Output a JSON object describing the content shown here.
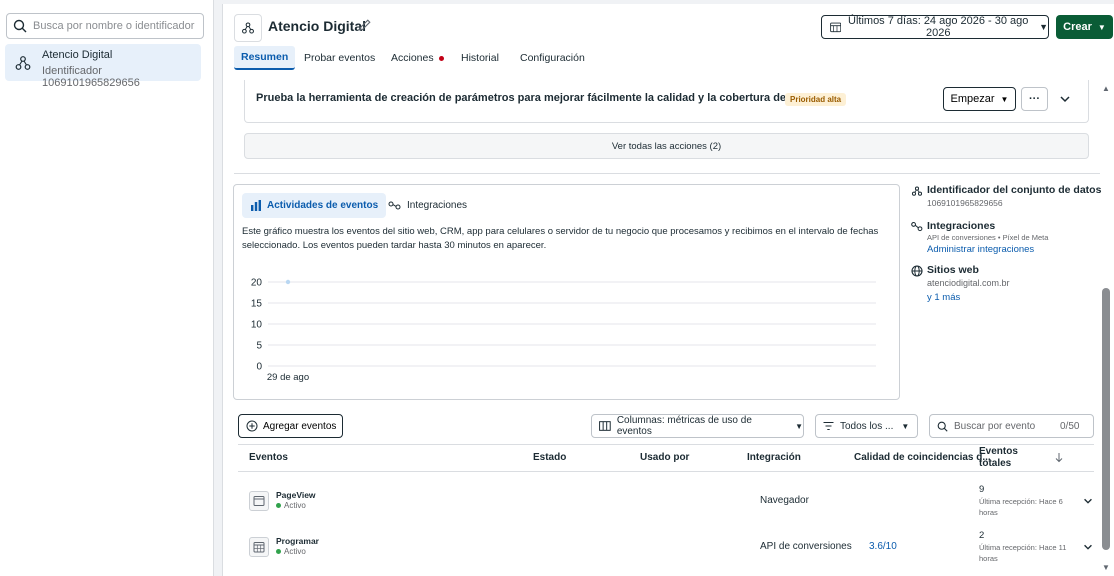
{
  "left_panel": {
    "search_placeholder": "Busca por nombre o identificador",
    "dataset": {
      "name": "Atencio Digital",
      "id_line": "Identificador 1069101965829656"
    }
  },
  "header": {
    "title": "Atencio Digital",
    "date_range": "Últimos 7 días: 24 ago 2026 - 30 ago 2026",
    "create_label": "Crear"
  },
  "tabs": [
    {
      "label": "Resumen",
      "active": true
    },
    {
      "label": "Probar eventos"
    },
    {
      "label": "Acciones",
      "has_alert_dot": true
    },
    {
      "label": "Historial"
    },
    {
      "label": "Configuración"
    }
  ],
  "action_card": {
    "text": "Prueba la herramienta de creación de parámetros para mejorar fácilmente la calidad y la cobertura de la fbc",
    "badge": "Prioridad alta",
    "start_label": "Empezar",
    "more_label": "···"
  },
  "view_all_label": "Ver todas las acciones (2)",
  "chart_panel": {
    "tab_activities": "Actividades de eventos",
    "tab_integrations": "Integraciones",
    "description": "Este gráfico muestra los eventos del sitio web, CRM, app para celulares o servidor de tu negocio que procesamos y recibimos en el intervalo de fechas seleccionado. Los eventos pueden tardar hasta 30 minutos en aparecer."
  },
  "chart_data": {
    "type": "line",
    "title": "",
    "xlabel": "",
    "ylabel": "",
    "x": [
      "29 de ago"
    ],
    "series": [
      {
        "values": [
          20
        ]
      }
    ],
    "y_ticks": [
      0,
      5,
      10,
      15,
      20
    ],
    "ylim": [
      0,
      20
    ],
    "grid": true,
    "colors": {
      "point": "#b9d7f2",
      "grid": "#e4e6eb"
    }
  },
  "info": {
    "dataset_id_title": "Identificador del conjunto de datos",
    "dataset_id_value": "1069101965829656",
    "integrations_title": "Integraciones",
    "integrations_sub": "API de conversiones • Píxel de Meta",
    "integrations_link": "Administrar integraciones",
    "websites_title": "Sitios web",
    "websites_value": "atenciodigital.com.br",
    "websites_more": "y 1 más"
  },
  "toolbar": {
    "add_events": "Agregar eventos",
    "columns": "Columnas: métricas de uso de eventos",
    "filter": "Todos los ...",
    "search_placeholder": "Buscar por evento",
    "search_count": "0/50"
  },
  "table": {
    "headers": {
      "events": "Eventos",
      "status": "Estado",
      "used_by": "Usado por",
      "integration": "Integración",
      "match_quality": "Calidad de coincidencias d...",
      "total_events": "Eventos totales",
      "sort_icon": "arrow-down-icon"
    },
    "rows": [
      {
        "name": "PageView",
        "status": "Activo",
        "integration": "Navegador",
        "match_quality": "",
        "total": "9",
        "last_received": "Última recepción: Hace 6 horas",
        "icon": "browser-window-icon"
      },
      {
        "name": "Programar",
        "status": "Activo",
        "integration": "API de conversiones",
        "match_quality": "3.6/10",
        "total": "2",
        "last_received": "Última recepción: Hace 11 horas",
        "icon": "calendar-icon"
      }
    ]
  },
  "colors": {
    "accent": "#0b5cad",
    "create_button": "#0a5c36",
    "active_status": "#31a24c",
    "priority_badge_bg": "#fdf0d5",
    "alert_dot": "#c20016"
  }
}
